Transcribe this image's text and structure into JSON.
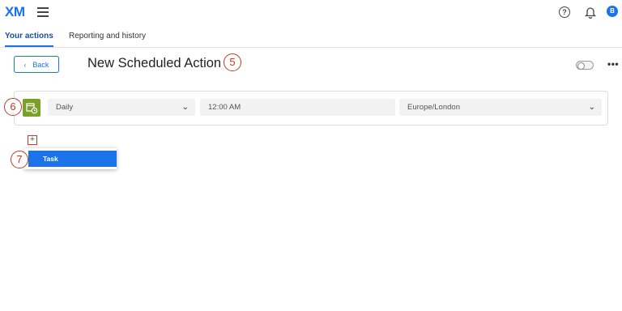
{
  "header": {
    "logo": "XM",
    "help_icon": "question-circle-icon",
    "notification_icon": "bell-icon",
    "avatar_initial": "B",
    "brand_color": "#1a73e8"
  },
  "tabs": [
    {
      "label": "Your actions",
      "active": true
    },
    {
      "label": "Reporting and history",
      "active": false
    }
  ],
  "toolbar": {
    "back_label": "Back",
    "page_title": "New Scheduled Action",
    "toggle_on": false,
    "more_label": "•••"
  },
  "schedule": {
    "icon": "calendar-clock-icon",
    "icon_color": "#7aa02a",
    "frequency": "Daily",
    "time": "12:00 AM",
    "timezone": "Europe/London"
  },
  "add_menu": {
    "plus_label": "+",
    "items": [
      {
        "label": "Task",
        "selected": true
      }
    ]
  },
  "callouts": [
    "5",
    "6",
    "7"
  ],
  "annotation_color": "#c0392b"
}
